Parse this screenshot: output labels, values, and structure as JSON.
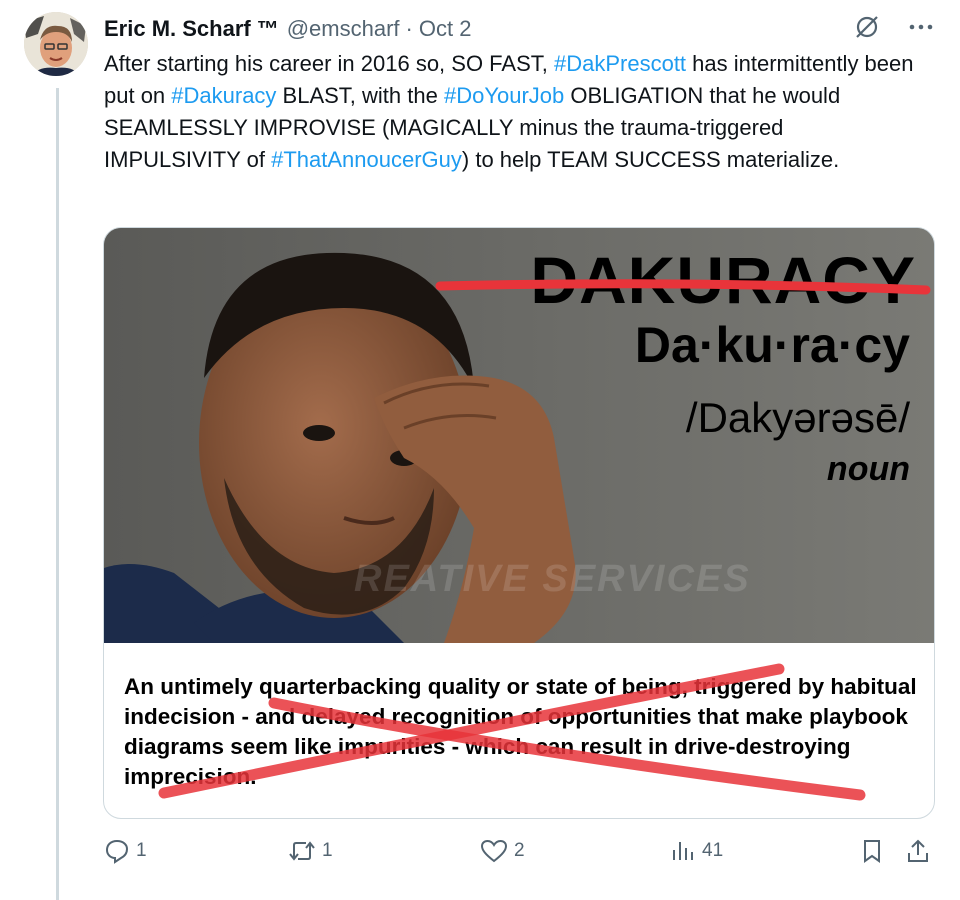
{
  "tweet": {
    "author_name": "Eric M. Scharf",
    "trademark": "™",
    "handle": "@emscharf",
    "separator": "·",
    "date": "Oct 2",
    "text_segments": [
      {
        "t": "After starting his career in 2016 so, SO FAST, ",
        "tag": false
      },
      {
        "t": "#DakPrescott",
        "tag": true
      },
      {
        "t": " has intermittently been put on ",
        "tag": false
      },
      {
        "t": "#Dakuracy",
        "tag": true
      },
      {
        "t": " BLAST, with the ",
        "tag": false
      },
      {
        "t": "#DoYourJob",
        "tag": true
      },
      {
        "t": " OBLIGATION that he would SEAMLESSLY IMPROVISE (MAGICALLY minus the trauma-triggered IMPULSIVITY of ",
        "tag": false
      },
      {
        "t": "#ThatAnnoucerGuy",
        "tag": true
      },
      {
        "t": ") to help TEAM SUCCESS materialize.",
        "tag": false
      }
    ]
  },
  "media": {
    "word": "DAKURACY",
    "syllables": "Da·ku·ra·cy",
    "pronunciation": "/Dakyərəsē/",
    "part_of_speech": "noun",
    "watermark": "REATIVE SERVICES",
    "definition": "An untimely quarterbacking quality or state of being, triggered by habitual indecision - and delayed recognition of opportunities that make playbook diagrams seem like impurities - which can result in drive-destroying imprecision.",
    "strike_color": "#e8343a"
  },
  "actions": {
    "reply_count": "1",
    "retweet_count": "1",
    "like_count": "2",
    "views_count": "41"
  },
  "colors": {
    "link": "#1d9bf0",
    "muted": "#536471",
    "text": "#0f1419"
  }
}
